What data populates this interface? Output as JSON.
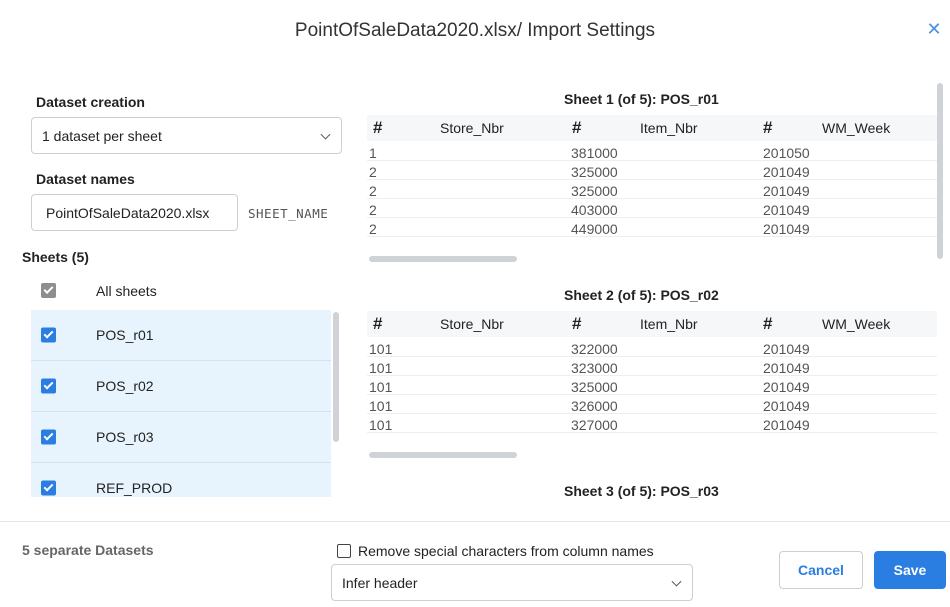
{
  "dialog": {
    "title": "PointOfSaleData2020.xlsx/ Import Settings"
  },
  "left": {
    "dataset_creation_label": "Dataset creation",
    "dataset_creation_value": "1 dataset per sheet",
    "dataset_names_label": "Dataset names",
    "dataset_name_value": "PointOfSaleData2020.xlsx",
    "sheet_name_token": "SHEET_NAME",
    "sheets_label": "Sheets (5)",
    "all_sheets_label": "All sheets",
    "sheets": [
      {
        "name": "POS_r01",
        "checked": true
      },
      {
        "name": "POS_r02",
        "checked": true
      },
      {
        "name": "POS_r03",
        "checked": true
      },
      {
        "name": "REF_PROD",
        "checked": true
      }
    ]
  },
  "previews": [
    {
      "title": "Sheet 1 (of 5): POS_r01",
      "columns": [
        "Store_Nbr",
        "Item_Nbr",
        "WM_Week"
      ],
      "type_glyph": "#",
      "rows": [
        [
          "1",
          "381000",
          "201050"
        ],
        [
          "2",
          "325000",
          "201049"
        ],
        [
          "2",
          "325000",
          "201049"
        ],
        [
          "2",
          "403000",
          "201049"
        ],
        [
          "2",
          "449000",
          "201049"
        ]
      ]
    },
    {
      "title": "Sheet 2 (of 5): POS_r02",
      "columns": [
        "Store_Nbr",
        "Item_Nbr",
        "WM_Week"
      ],
      "type_glyph": "#",
      "rows": [
        [
          "101",
          "322000",
          "201049"
        ],
        [
          "101",
          "323000",
          "201049"
        ],
        [
          "101",
          "325000",
          "201049"
        ],
        [
          "101",
          "326000",
          "201049"
        ],
        [
          "101",
          "327000",
          "201049"
        ]
      ]
    },
    {
      "title": "Sheet 3 (of 5): POS_r03"
    }
  ],
  "footer": {
    "status": "5 separate Datasets",
    "remove_special_chars_label": "Remove special characters from column names",
    "remove_special_chars_checked": false,
    "header_option": "Infer header",
    "cancel_label": "Cancel",
    "save_label": "Save"
  },
  "colors": {
    "accent": "#2a7de1",
    "selection_bg": "#e8f4fd"
  },
  "icons": {
    "close": "close-icon",
    "dropdown": "chevron-down-icon"
  }
}
